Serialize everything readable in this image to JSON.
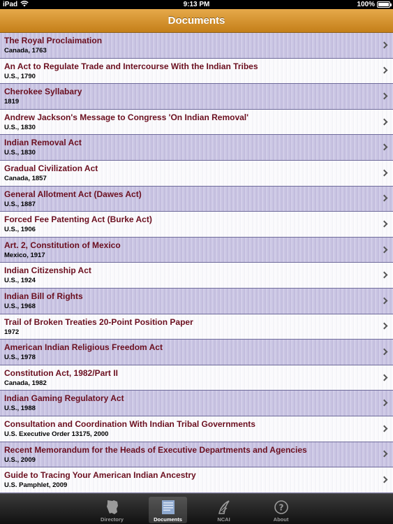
{
  "status_bar": {
    "device": "iPad",
    "time": "9:13 PM",
    "battery": "100%"
  },
  "nav": {
    "title": "Documents"
  },
  "documents": [
    {
      "title": "The Royal Proclaimation",
      "subtitle": "Canada, 1763"
    },
    {
      "title": "An Act to Regulate Trade and Intercourse With the Indian Tribes",
      "subtitle": "U.S., 1790"
    },
    {
      "title": "Cherokee Syllabary",
      "subtitle": "1819"
    },
    {
      "title": "Andrew Jackson's Message to Congress 'On Indian Removal'",
      "subtitle": "U.S., 1830"
    },
    {
      "title": "Indian Removal Act",
      "subtitle": "U.S., 1830"
    },
    {
      "title": "Gradual Civilization Act",
      "subtitle": "Canada, 1857"
    },
    {
      "title": "General Allotment Act (Dawes Act)",
      "subtitle": "U.S., 1887"
    },
    {
      "title": "Forced Fee Patenting Act (Burke Act)",
      "subtitle": "U.S., 1906"
    },
    {
      "title": "Art. 2, Constitution of Mexico",
      "subtitle": "Mexico, 1917"
    },
    {
      "title": "Indian Citizenship Act",
      "subtitle": "U.S., 1924"
    },
    {
      "title": "Indian Bill of Rights",
      "subtitle": "U.S., 1968"
    },
    {
      "title": "Trail of Broken Treaties 20-Point Position Paper",
      "subtitle": "1972"
    },
    {
      "title": "American Indian Religious Freedom Act",
      "subtitle": "U.S., 1978"
    },
    {
      "title": "Constitution Act, 1982/Part II",
      "subtitle": "Canada, 1982"
    },
    {
      "title": "Indian Gaming Regulatory Act",
      "subtitle": "U.S., 1988"
    },
    {
      "title": "Consultation and Coordination With Indian Tribal Governments",
      "subtitle": "U.S. Executive Order 13175, 2000"
    },
    {
      "title": "Recent Memorandum for the Heads of Executive Departments and Agencies",
      "subtitle": "U.S., 2009"
    },
    {
      "title": "Guide to Tracing Your American Indian Ancestry",
      "subtitle": "U.S. Pamphlet, 2009"
    }
  ],
  "tabs": [
    {
      "label": "Directory",
      "icon": "map-icon",
      "selected": false
    },
    {
      "label": "Documents",
      "icon": "document-icon",
      "selected": true
    },
    {
      "label": "NCAI",
      "icon": "ncai-logo-icon",
      "selected": false
    },
    {
      "label": "About",
      "icon": "question-icon",
      "selected": false
    }
  ],
  "colors": {
    "nav_bar": "#d4922e",
    "title_text": "#6b0f1f",
    "row_shade": "#c9c4e2"
  }
}
